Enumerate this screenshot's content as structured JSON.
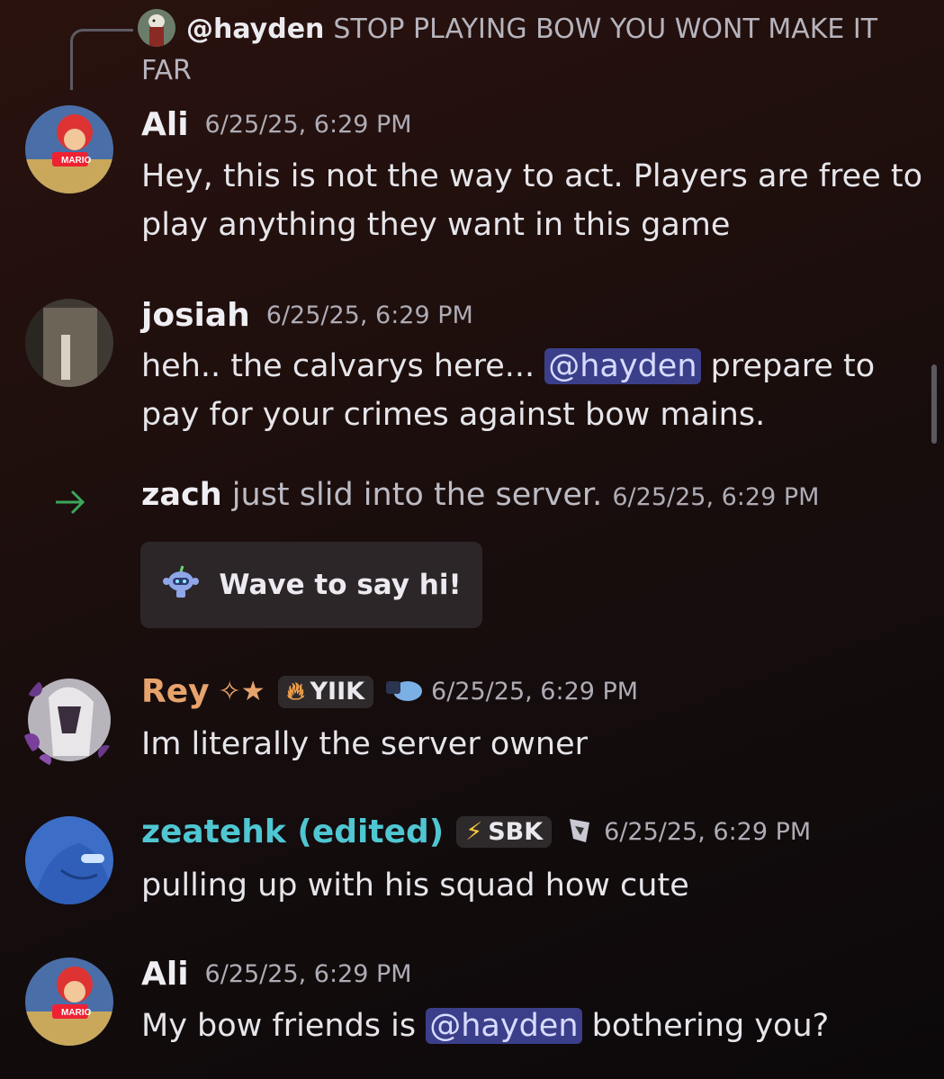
{
  "reply": {
    "author": "@hayden",
    "text": "STOP PLAYING BOW YOU WONT MAKE IT FAR"
  },
  "messages": [
    {
      "author": "Ali",
      "time": "6/25/25, 6:29 PM",
      "lines": [
        "Hey, this is not the way to act. Players are free to",
        "play anything they want in this game"
      ]
    },
    {
      "author": "josiah",
      "time": "6/25/25, 6:29 PM",
      "line1_before": "heh.. the calvarys here... ",
      "line1_mention": "@hayden",
      "line1_after": " prepare to",
      "line2": "pay for your crimes against bow mains."
    },
    {
      "author": "Rey",
      "author_color": "#e8a36c",
      "tag": "YIIK",
      "time": "6/25/25, 6:29 PM",
      "text": "Im literally the server owner"
    },
    {
      "author": "zeatehk (edited)",
      "author_color": "#4fc6d2",
      "tag": "SBK",
      "time": "6/25/25, 6:29 PM",
      "text": "pulling up with his squad how cute"
    },
    {
      "author": "Ali",
      "time": "6/25/25, 6:29 PM",
      "before": "My bow friends is ",
      "mention": "@hayden",
      "after": " bothering you?"
    }
  ],
  "join": {
    "icon": "arrow-right-icon",
    "name": "zach",
    "text": " just slid into the server. ",
    "time": "6/25/25, 6:29 PM",
    "wave_label": "Wave to say hi!"
  }
}
